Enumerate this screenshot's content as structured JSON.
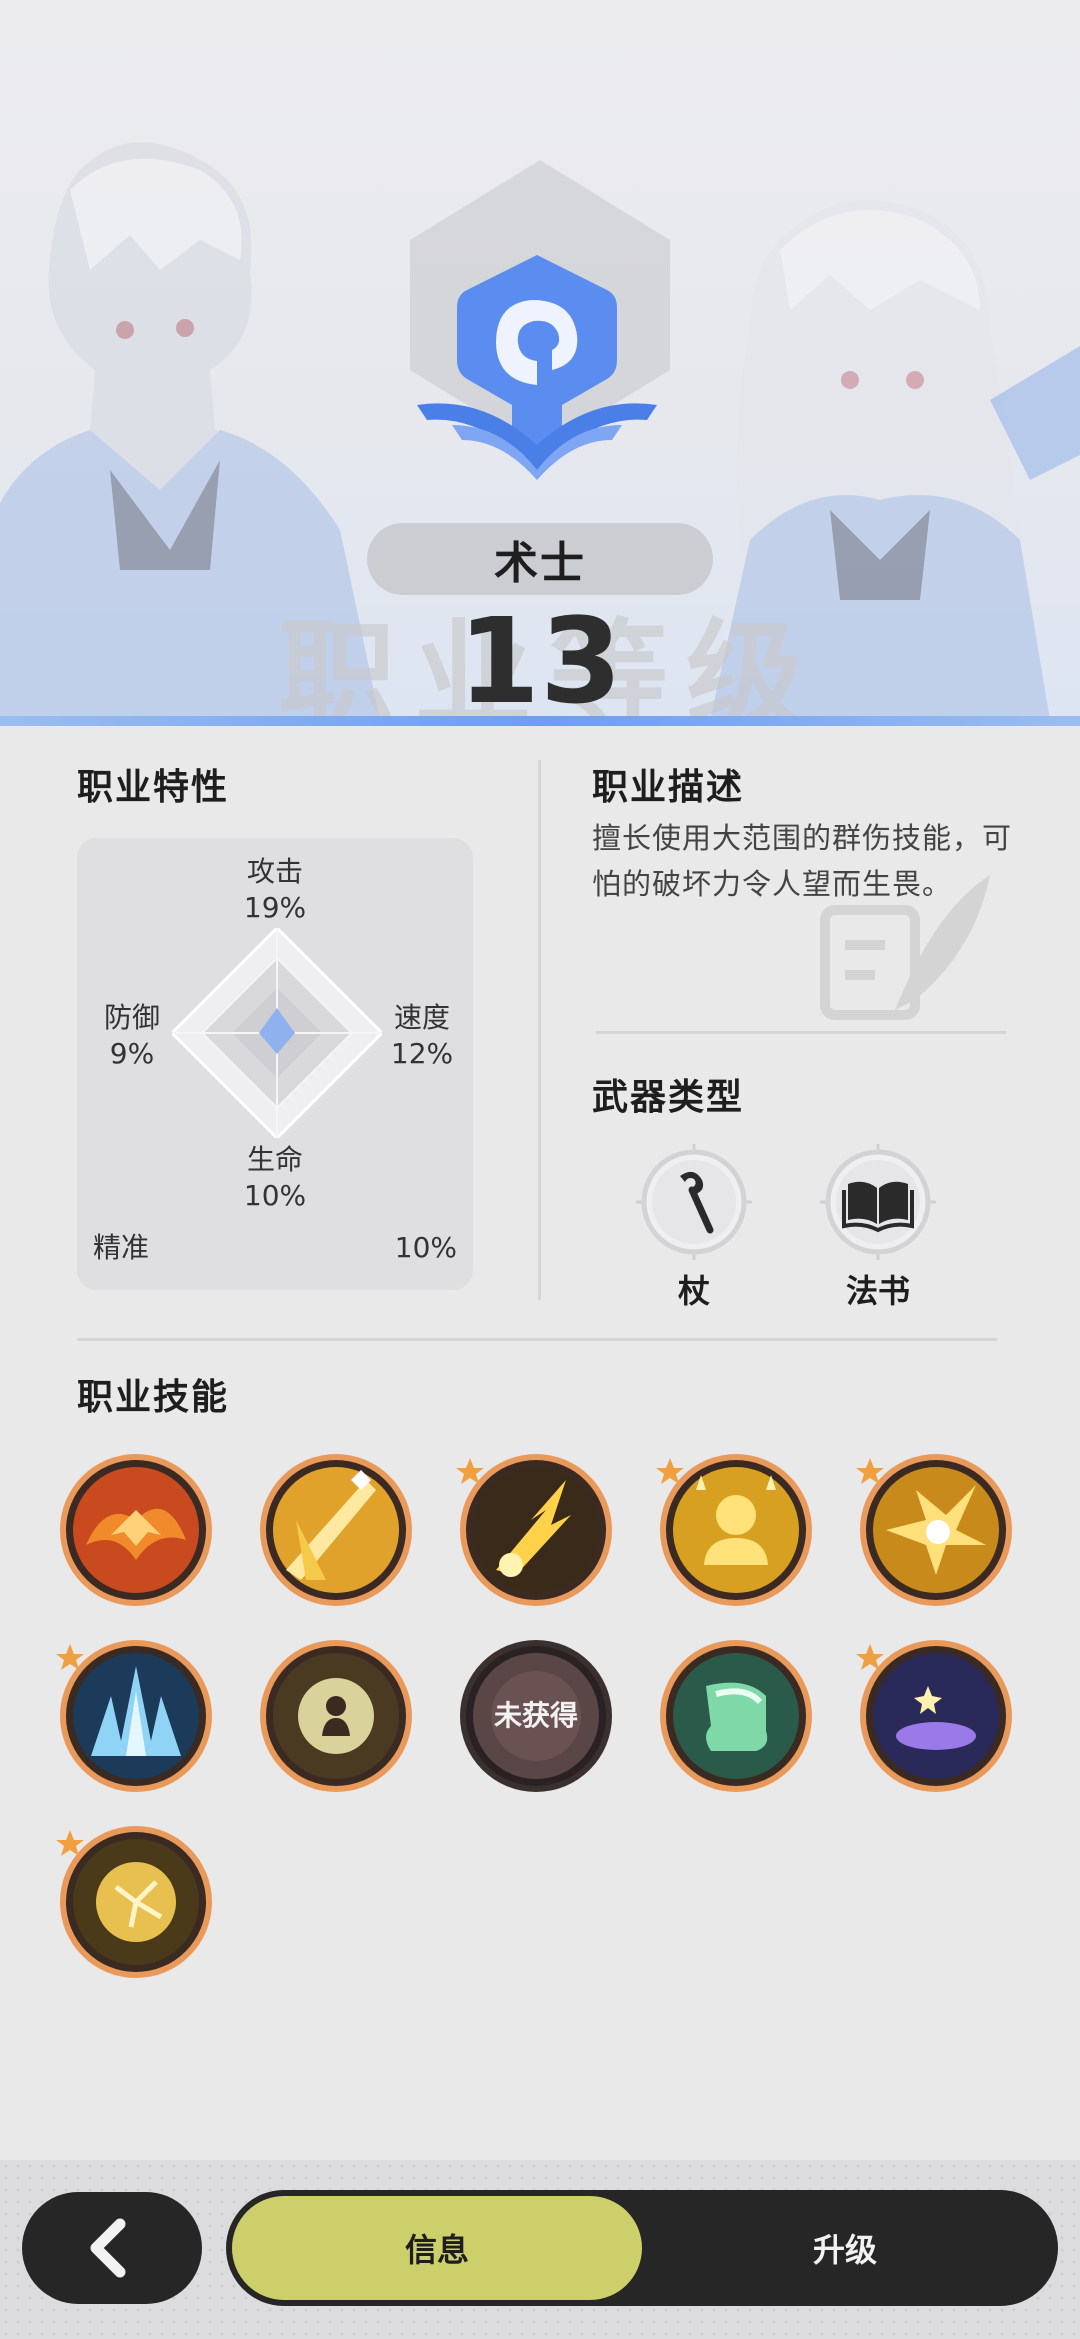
{
  "header": {
    "class_name": "术士",
    "level": "13",
    "background_caption": "职业等级",
    "accent_color": "#6d9ef0"
  },
  "attributes": {
    "title": "职业特性",
    "attack": {
      "name": "攻击",
      "value": "19%"
    },
    "defense": {
      "name": "防御",
      "value": "9%"
    },
    "speed": {
      "name": "速度",
      "value": "12%"
    },
    "life": {
      "name": "生命",
      "value": "10%"
    },
    "precision": {
      "name": "精准",
      "value": "10%"
    }
  },
  "description": {
    "title": "职业描述",
    "text": "擅长使用大范围的群伤技能，可怕的破坏力令人望而生畏。"
  },
  "weapons": {
    "title": "武器类型",
    "items": [
      {
        "label": "杖",
        "icon": "staff-icon"
      },
      {
        "label": "法书",
        "icon": "spellbook-icon"
      }
    ]
  },
  "skills": {
    "title": "职业技能",
    "locked_label": "未获得",
    "items": [
      {
        "icon": "fire-skill-icon",
        "starred": false,
        "locked": false
      },
      {
        "icon": "light-wand-skill-icon",
        "starred": false,
        "locked": false
      },
      {
        "icon": "lightning-skill-icon",
        "starred": true,
        "locked": false
      },
      {
        "icon": "golden-aura-skill-icon",
        "starred": true,
        "locked": false
      },
      {
        "icon": "burst-skill-icon",
        "starred": true,
        "locked": false
      },
      {
        "icon": "ice-crystal-skill-icon",
        "starred": true,
        "locked": false
      },
      {
        "icon": "shield-person-skill-icon",
        "starred": false,
        "locked": false
      },
      {
        "icon": "locked-skill-icon",
        "starred": false,
        "locked": true
      },
      {
        "icon": "green-boot-skill-icon",
        "starred": false,
        "locked": false
      },
      {
        "icon": "starry-circle-skill-icon",
        "starred": true,
        "locked": false
      },
      {
        "icon": "golden-orb-skill-icon",
        "starred": true,
        "locked": false
      }
    ]
  },
  "nav": {
    "back_icon": "chevron-left-icon",
    "tabs": [
      {
        "label": "信息",
        "active": true
      },
      {
        "label": "升级",
        "active": false
      }
    ]
  }
}
